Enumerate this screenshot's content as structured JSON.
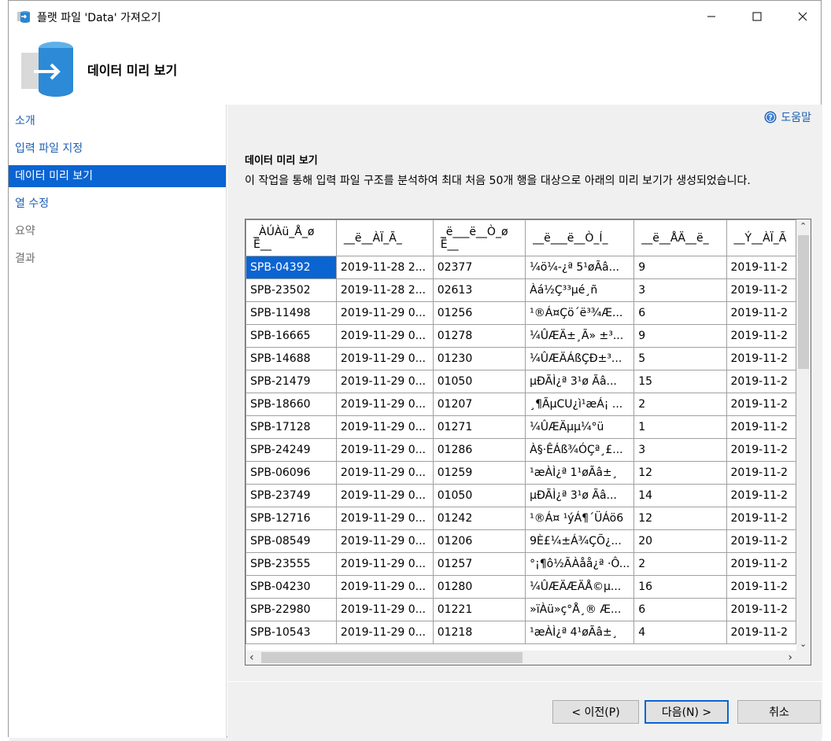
{
  "window": {
    "title": "플랫 파일 'Data' 가져오기"
  },
  "header": {
    "title": "데이터 미리 보기"
  },
  "sidebar": {
    "items": [
      {
        "label": "소개"
      },
      {
        "label": "입력 파일 지정"
      },
      {
        "label": "데이터 미리 보기"
      },
      {
        "label": "열 수정"
      },
      {
        "label": "요약"
      },
      {
        "label": "결과"
      }
    ],
    "active_index": 2
  },
  "help": {
    "label": "도움말"
  },
  "content": {
    "section_title": "데이터 미리 보기",
    "description": "이 작업을 통해 입력 파일 구조를 분석하여 최대 처음 50개 행을 대상으로 아래의 미리 보기가 생성되었습니다."
  },
  "grid": {
    "columns": [
      "_ÀÚÀü_Å_ø Ë__",
      "__ë__ÀÏ_Ã_",
      "_ë___ë__Ò_ø Ë__",
      "__ë___ë__Ò_Í_",
      "__ë__ÅÄ__ë_",
      "__Ý__ÀÏ_Ã"
    ],
    "rows": [
      [
        "SPB-04392",
        "2019-11-28 2...",
        "02377",
        "¼ö¼-¿ª 5¹øÃâ...",
        "9",
        "2019-11-2"
      ],
      [
        "SPB-23502",
        "2019-11-28 2...",
        "02613",
        "Àá½Ç³³µé¸ñ",
        "3",
        "2019-11-2"
      ],
      [
        "SPB-11498",
        "2019-11-29 0...",
        "01256",
        "¹®Á¤Çö´ë³¾Æ...",
        "6",
        "2019-11-2"
      ],
      [
        "SPB-16665",
        "2019-11-29 0...",
        "01278",
        "¼ÛÆÄ±¸Ã» ±³...",
        "9",
        "2019-11-2"
      ],
      [
        "SPB-14688",
        "2019-11-29 0...",
        "01230",
        "¼ÛÆÄÁßÇÐ±³...",
        "5",
        "2019-11-2"
      ],
      [
        "SPB-21479",
        "2019-11-29 0...",
        "01050",
        "µÐÃÌ¿ª 3¹ø Ãâ...",
        "15",
        "2019-11-2"
      ],
      [
        "SPB-18660",
        "2019-11-29 0...",
        "01207",
        "¸¶ÃµCU¿ì¹æÁ¡ ...",
        "2",
        "2019-11-2"
      ],
      [
        "SPB-17128",
        "2019-11-29 0...",
        "01271",
        "¼ÛÆÄµµ¼­°ü",
        "1",
        "2019-11-2"
      ],
      [
        "SPB-24249",
        "2019-11-29 0...",
        "01286",
        "À§·ÊÁß¾ÓÇª¸£...",
        "3",
        "2019-11-2"
      ],
      [
        "SPB-06096",
        "2019-11-29 0...",
        "01259",
        "¹æÀÌ¿ª 1¹øÃâ±¸",
        "12",
        "2019-11-2"
      ],
      [
        "SPB-23749",
        "2019-11-29 0...",
        "01050",
        "µÐÃÌ¿ª 3¹ø Ãâ...",
        "14",
        "2019-11-2"
      ],
      [
        "SPB-12716",
        "2019-11-29 0...",
        "01242",
        "¹®Á¤ ¹ýÁ¶´ÜÁö6",
        "12",
        "2019-11-2"
      ],
      [
        "SPB-08549",
        "2019-11-29 0...",
        "01206",
        "9È£¼±Á¾ÇÕ¿...",
        "20",
        "2019-11-2"
      ],
      [
        "SPB-23555",
        "2019-11-29 0...",
        "01257",
        "°¡¶ô½ÃÀåå¿ª ·Ô...",
        "2",
        "2019-11-2"
      ],
      [
        "SPB-04230",
        "2019-11-29 0...",
        "01280",
        "¼ÛÆÄÆÄÅ©µ...",
        "16",
        "2019-11-2"
      ],
      [
        "SPB-22980",
        "2019-11-29 0...",
        "01221",
        "»ïÀü»ç°Å¸® Æ...",
        "6",
        "2019-11-2"
      ],
      [
        "SPB-10543",
        "2019-11-29 0...",
        "01218",
        "¹æÀÌ¿ª 4¹øÃâ±¸",
        "4",
        "2019-11-2"
      ]
    ]
  },
  "buttons": {
    "prev": "< 이전(P)",
    "next": "다음(N) >",
    "cancel": "취소"
  }
}
